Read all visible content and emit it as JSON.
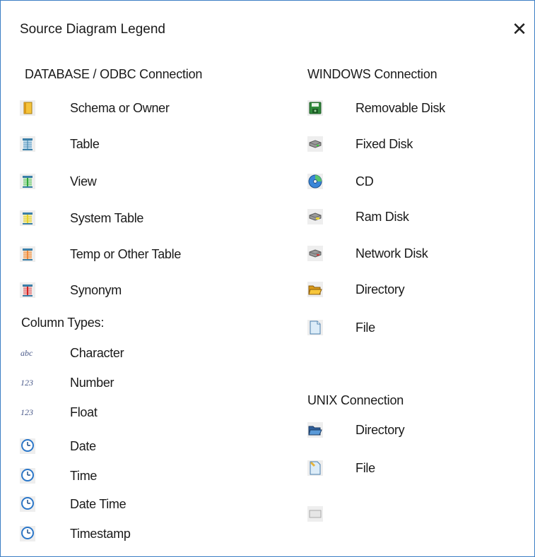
{
  "window": {
    "title": "Source Diagram Legend",
    "close_glyph": "✕"
  },
  "left": {
    "db_header": "DATABASE / ODBC  Connection",
    "db_items": [
      {
        "label": "Schema or Owner",
        "icon": "schema-icon"
      },
      {
        "label": "Table",
        "icon": "table-icon"
      },
      {
        "label": "View",
        "icon": "view-icon"
      },
      {
        "label": "System Table",
        "icon": "system-table-icon"
      },
      {
        "label": "Temp or Other Table",
        "icon": "temp-table-icon"
      },
      {
        "label": "Synonym",
        "icon": "synonym-icon"
      }
    ],
    "col_header": "Column Types:",
    "col_items": [
      {
        "label": "Character",
        "icon": "character-icon",
        "glyph": "abc"
      },
      {
        "label": "Number",
        "icon": "number-icon",
        "glyph": "123"
      },
      {
        "label": "Float",
        "icon": "float-icon",
        "glyph": "123"
      },
      {
        "label": "Date",
        "icon": "clock-icon"
      },
      {
        "label": "Time",
        "icon": "clock-icon"
      },
      {
        "label": "Date Time",
        "icon": "clock-icon"
      },
      {
        "label": "Timestamp",
        "icon": "clock-icon"
      }
    ]
  },
  "right": {
    "win_header": "WINDOWS Connection",
    "win_items": [
      {
        "label": "Removable Disk",
        "icon": "removable-disk-icon"
      },
      {
        "label": "Fixed Disk",
        "icon": "fixed-disk-icon"
      },
      {
        "label": "CD",
        "icon": "cd-icon"
      },
      {
        "label": "Ram Disk",
        "icon": "ram-disk-icon"
      },
      {
        "label": "Network Disk",
        "icon": "network-disk-icon"
      },
      {
        "label": "Directory",
        "icon": "folder-icon"
      },
      {
        "label": "File",
        "icon": "file-icon"
      }
    ],
    "unix_header": "UNIX Connection",
    "unix_items": [
      {
        "label": "Directory",
        "icon": "unix-folder-icon"
      },
      {
        "label": "File",
        "icon": "unix-file-icon"
      }
    ],
    "extra_icon": "blank-icon"
  },
  "colors": {
    "border": "#3c7fc4",
    "table_blue": "#3a7fa8",
    "view_green": "#2fa83a",
    "system_yellow": "#e8d32a",
    "temp_orange": "#f08a3a",
    "synonym_red": "#d42020",
    "clock_blue": "#2b77c9"
  }
}
